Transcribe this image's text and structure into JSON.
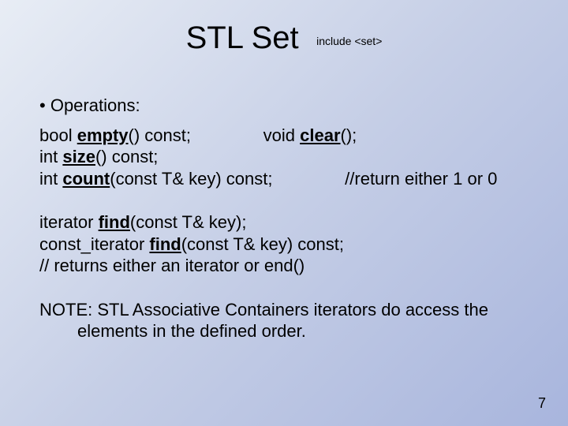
{
  "title": "STL Set",
  "subtitle": "include <set>",
  "heading": "Operations:",
  "ops": {
    "l1a": "bool ",
    "l1kw": "empty",
    "l1b": "() const;               void ",
    "l1kw2": "clear",
    "l1c": "();",
    "l2a": "int ",
    "l2kw": "size",
    "l2b": "() const;",
    "l3a": "int ",
    "l3kw": "count",
    "l3b": "(const T& key) const;",
    "l3comment": "               //return either 1 or 0"
  },
  "iter": {
    "l1a": "iterator ",
    "l1kw": "find",
    "l1b": "(const T& key);",
    "l2a": "const_iterator ",
    "l2kw": "find",
    "l2b": "(const T& key) const;",
    "l3": "// returns either an iterator or end()"
  },
  "note": {
    "line1": "NOTE: STL Associative Containers iterators do access the",
    "line2": "elements in the defined order."
  },
  "page": "7"
}
